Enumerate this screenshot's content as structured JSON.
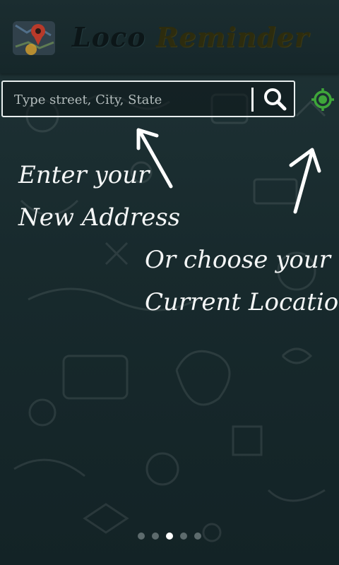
{
  "header": {
    "title_word1": "Loco",
    "title_word2": "Reminder",
    "logo_icon": "map-pin-logo-icon"
  },
  "search": {
    "placeholder": "Type street, City, State",
    "value": "",
    "button_icon": "search-icon"
  },
  "locate": {
    "icon": "gps-target-icon",
    "color": "#3fa63a"
  },
  "hints": {
    "address_line1": "Enter your",
    "address_line2": "New Address",
    "location_line1": "Or choose your",
    "location_line2": "Current Location"
  },
  "pager": {
    "total": 5,
    "current": 3
  },
  "colors": {
    "background": "#1a2d30",
    "text": "#f4f6f6",
    "accent_green": "#3fa63a"
  }
}
